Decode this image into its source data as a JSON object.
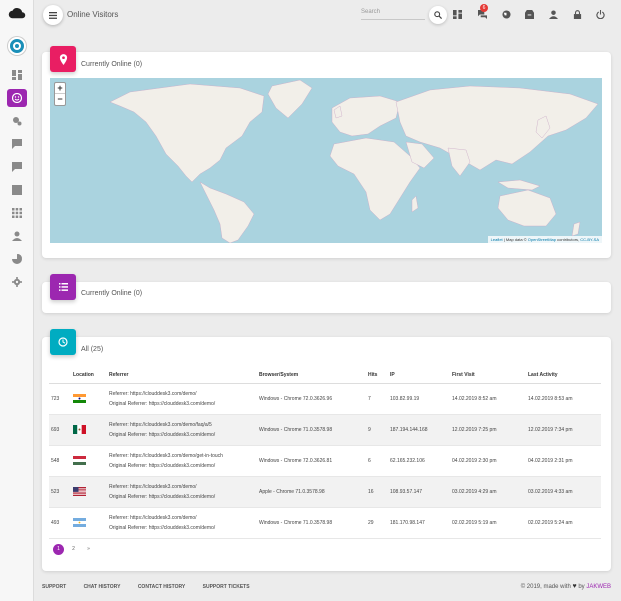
{
  "header": {
    "page_title": "Online Visitors",
    "search_placeholder": "Search",
    "notification_count": "6"
  },
  "sidebar": {
    "items": [
      "dashboard-icon",
      "support-icon",
      "settings-cog-icon",
      "chat-icon",
      "message-icon",
      "form-icon",
      "grid-icon",
      "user-icon",
      "chart-icon",
      "gear-icon"
    ]
  },
  "map_card": {
    "title": "Currently Online (0)",
    "zoom_in": "+",
    "zoom_out": "−",
    "attribution_leaflet": "Leaflet",
    "attribution_text": " | Map data © ",
    "attribution_osm": "OpenStreetMap",
    "attribution_contrib": " contributors, ",
    "attribution_license": "CC-BY-SA"
  },
  "list_card": {
    "title": "Currently Online (0)"
  },
  "all_card": {
    "title": "All (25)",
    "columns": [
      "",
      "Location",
      "Referrer",
      "Browser/System",
      "Hits",
      "IP",
      "First Visit",
      "Last Activity"
    ],
    "rows": [
      {
        "id": "723",
        "country": "india",
        "ref": "Referrer: https://clouddesk3.com/demo/",
        "orig": "Original Referrer: https://clouddesk3.com/demo/",
        "browser": "Windows - Chrome 72.0.3626.96",
        "hits": "7",
        "ip": "103.82.99.19",
        "first": "14.02.2019 8:52 am",
        "last": "14.02.2019 8:53 am"
      },
      {
        "id": "693",
        "country": "mexico",
        "ref": "Referrer: https://clouddesk3.com/demo/faq/a/5",
        "orig": "Original Referrer: https://clouddesk3.com/demo/",
        "browser": "Windows - Chrome 71.0.3578.98",
        "hits": "9",
        "ip": "187.194.144.168",
        "first": "12.02.2019 7:25 pm",
        "last": "12.02.2019 7:34 pm"
      },
      {
        "id": "548",
        "country": "hungary",
        "ref": "Referrer: https://clouddesk3.com/demo/get-in-touch",
        "orig": "Original Referrer: https://clouddesk3.com/demo/",
        "browser": "Windows - Chrome 72.0.3626.81",
        "hits": "6",
        "ip": "62.165.232.106",
        "first": "04.02.2019 2:30 pm",
        "last": "04.02.2019 2:31 pm"
      },
      {
        "id": "523",
        "country": "usa",
        "ref": "Referrer: https://clouddesk3.com/demo/",
        "orig": "Original Referrer: https://clouddesk3.com/demo/",
        "browser": "Apple - Chrome 71.0.3578.98",
        "hits": "16",
        "ip": "108.93.57.147",
        "first": "03.02.2019 4:29 am",
        "last": "03.02.2019 4:33 am"
      },
      {
        "id": "493",
        "country": "argentina",
        "ref": "Referrer: https://clouddesk3.com/demo/",
        "orig": "Original Referrer: https://clouddesk3.com/demo/",
        "browser": "Windows - Chrome 71.0.3578.98",
        "hits": "29",
        "ip": "181.170.98.147",
        "first": "02.02.2019 5:19 am",
        "last": "02.02.2019 5:24 am"
      }
    ]
  },
  "pagination": {
    "pages": [
      "1",
      "2",
      "»"
    ]
  },
  "footer": {
    "links": [
      "SUPPORT",
      "CHAT HISTORY",
      "CONTACT HISTORY",
      "SUPPORT TICKETS"
    ],
    "copy_prefix": "© 2019, made with ",
    "copy_by": " by ",
    "copy_brand": "JAKWEB"
  },
  "colors": {
    "accent_purple": "#9c27b0",
    "pink": "#e91e63",
    "teal": "#00acc1",
    "ocean": "#aad3df",
    "land": "#f2efe9"
  }
}
